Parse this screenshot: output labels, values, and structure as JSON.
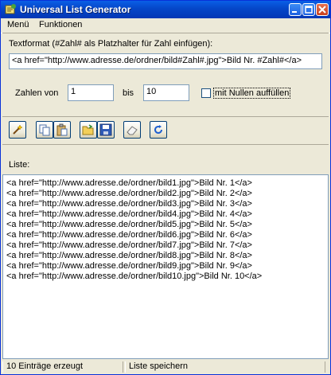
{
  "window": {
    "title": "Universal List Generator"
  },
  "menu": {
    "items": [
      {
        "label": "Menü"
      },
      {
        "label": "Funktionen"
      }
    ]
  },
  "format": {
    "label": "Textformat (#Zahl# als Platzhalter für Zahl einfügen):",
    "value": "<a href=\"http://www.adresse.de/ordner/bild#Zahl#.jpg\">Bild Nr. #Zahl#</a>"
  },
  "range": {
    "from_label": "Zahlen von",
    "from_value": "1",
    "to_label": "bis",
    "to_value": "10",
    "pad_label": "mit Nullen auffüllen",
    "pad_checked": false
  },
  "toolbar": {
    "icons": [
      "wand-icon",
      "copy-icon",
      "paste-icon",
      "open-folder-icon",
      "save-icon",
      "eraser-icon",
      "refresh-icon"
    ]
  },
  "list": {
    "label": "Liste:",
    "lines": [
      "<a href=\"http://www.adresse.de/ordner/bild1.jpg\">Bild Nr. 1</a>",
      "<a href=\"http://www.adresse.de/ordner/bild2.jpg\">Bild Nr. 2</a>",
      "<a href=\"http://www.adresse.de/ordner/bild3.jpg\">Bild Nr. 3</a>",
      "<a href=\"http://www.adresse.de/ordner/bild4.jpg\">Bild Nr. 4</a>",
      "<a href=\"http://www.adresse.de/ordner/bild5.jpg\">Bild Nr. 5</a>",
      "<a href=\"http://www.adresse.de/ordner/bild6.jpg\">Bild Nr. 6</a>",
      "<a href=\"http://www.adresse.de/ordner/bild7.jpg\">Bild Nr. 7</a>",
      "<a href=\"http://www.adresse.de/ordner/bild8.jpg\">Bild Nr. 8</a>",
      "<a href=\"http://www.adresse.de/ordner/bild9.jpg\">Bild Nr. 9</a>",
      "<a href=\"http://www.adresse.de/ordner/bild10.jpg\">Bild Nr. 10</a>"
    ]
  },
  "status": {
    "count_text": "10 Einträge erzeugt",
    "hint_text": "Liste speichern"
  },
  "colors": {
    "titlebar": "#0546c8",
    "face": "#ece9d8",
    "border": "#7f9db9"
  }
}
